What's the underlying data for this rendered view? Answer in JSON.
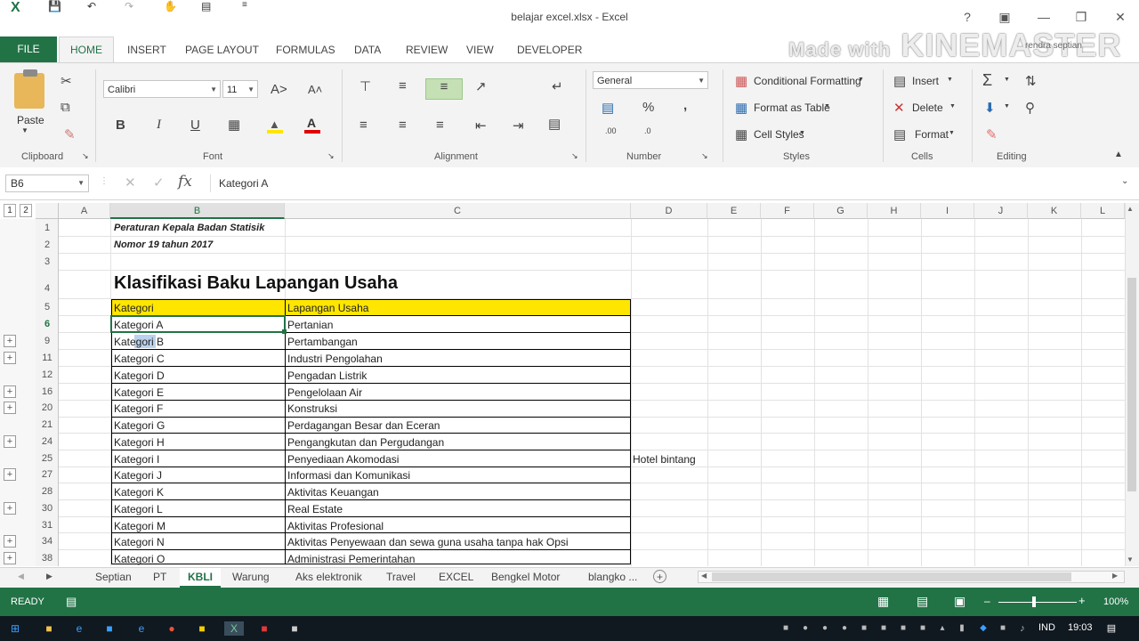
{
  "window": {
    "title": "belajar excel.xlsx - Excel"
  },
  "quick_access": [
    "excel-logo-icon",
    "save-icon",
    "undo-icon",
    "redo-icon",
    "touch-mode-icon",
    "form-icon",
    "customize-icon"
  ],
  "tabs": [
    "FILE",
    "HOME",
    "INSERT",
    "PAGE LAYOUT",
    "FORMULAS",
    "DATA",
    "REVIEW",
    "VIEW",
    "DEVELOPER"
  ],
  "watermark": {
    "made_with": "Made with",
    "brand": "KINEMASTER"
  },
  "signin": "rendra septian",
  "ribbon": {
    "clipboard": {
      "paste": "Paste",
      "group": "Clipboard"
    },
    "font": {
      "name": "Calibri",
      "size": "11",
      "bold": "B",
      "italic": "I",
      "underline": "U",
      "group": "Font"
    },
    "alignment": {
      "group": "Alignment"
    },
    "number": {
      "format": "General",
      "percent": "%",
      "comma": ",",
      "group": "Number"
    },
    "styles": {
      "conditional": "Conditional Formatting",
      "table": "Format as Table",
      "cell": "Cell Styles",
      "group": "Styles"
    },
    "cells": {
      "insert": "Insert",
      "delete": "Delete",
      "format": "Format",
      "group": "Cells"
    },
    "editing": {
      "group": "Editing"
    }
  },
  "formula_bar": {
    "name_box": "B6",
    "fx": "fx",
    "value": "Kategori A"
  },
  "outline_levels": [
    "1",
    "2"
  ],
  "columns": [
    "A",
    "B",
    "C",
    "D",
    "E",
    "F",
    "G",
    "H",
    "I",
    "J",
    "K",
    "L"
  ],
  "sheet": {
    "note1": "Peraturan Kepala Badan Statisik",
    "note2": "Nomor 19 tahun 2017",
    "title": "Klasifikasi Baku Lapangan Usaha",
    "header": {
      "kategori": "Kategori",
      "lapangan": "Lapangan Usaha"
    },
    "rows": [
      {
        "num": "1",
        "plus": false
      },
      {
        "num": "2",
        "plus": false
      },
      {
        "num": "3",
        "plus": false
      },
      {
        "num": "4",
        "plus": false
      },
      {
        "num": "5",
        "plus": false
      },
      {
        "num": "6",
        "plus": false,
        "kategori": "Kategori A",
        "lapangan": "Pertanian"
      },
      {
        "num": "9",
        "plus": true,
        "kategori": "Kategori B",
        "lapangan": "Pertambangan"
      },
      {
        "num": "11",
        "plus": true,
        "kategori": "Kategori C",
        "lapangan": "Industri Pengolahan"
      },
      {
        "num": "12",
        "plus": false,
        "kategori": "Kategori D",
        "lapangan": "Pengadan Listrik"
      },
      {
        "num": "16",
        "plus": true,
        "kategori": "Kategori E",
        "lapangan": "Pengelolaan Air"
      },
      {
        "num": "20",
        "plus": true,
        "kategori": "Kategori F",
        "lapangan": "Konstruksi"
      },
      {
        "num": "21",
        "plus": false,
        "kategori": "Kategori G",
        "lapangan": "Perdagangan Besar dan Eceran"
      },
      {
        "num": "24",
        "plus": true,
        "kategori": "Kategori H",
        "lapangan": "Pengangkutan dan Pergudangan"
      },
      {
        "num": "25",
        "plus": false,
        "kategori": "Kategori I",
        "lapangan": "Penyediaan Akomodasi",
        "d": "Hotel bintang"
      },
      {
        "num": "27",
        "plus": true,
        "kategori": "Kategori J",
        "lapangan": "Informasi dan Komunikasi"
      },
      {
        "num": "28",
        "plus": false,
        "kategori": "Kategori K",
        "lapangan": "Aktivitas Keuangan"
      },
      {
        "num": "30",
        "plus": true,
        "kategori": "Kategori L",
        "lapangan": "Real Estate"
      },
      {
        "num": "31",
        "plus": false,
        "kategori": "Kategori M",
        "lapangan": "Aktivitas Profesional"
      },
      {
        "num": "34",
        "plus": true,
        "kategori": "Kategori N",
        "lapangan": "Aktivitas Penyewaan dan sewa guna usaha tanpa hak Opsi"
      },
      {
        "num": "38",
        "plus": true,
        "kategori": "Kategori O",
        "lapangan": "Administrasi Pemerintahan"
      }
    ]
  },
  "sheet_tabs": [
    "Septian",
    "PT",
    "KBLI",
    "Warung",
    "Aks elektronik",
    "Travel",
    "EXCEL",
    "Bengkel Motor",
    "blangko ..."
  ],
  "active_sheet": "KBLI",
  "status": {
    "ready": "READY",
    "zoom": "100%"
  },
  "taskbar": {
    "lang": "IND",
    "time": "19:03"
  },
  "colors": {
    "accent": "#217346",
    "header_fill": "#FFE600"
  }
}
